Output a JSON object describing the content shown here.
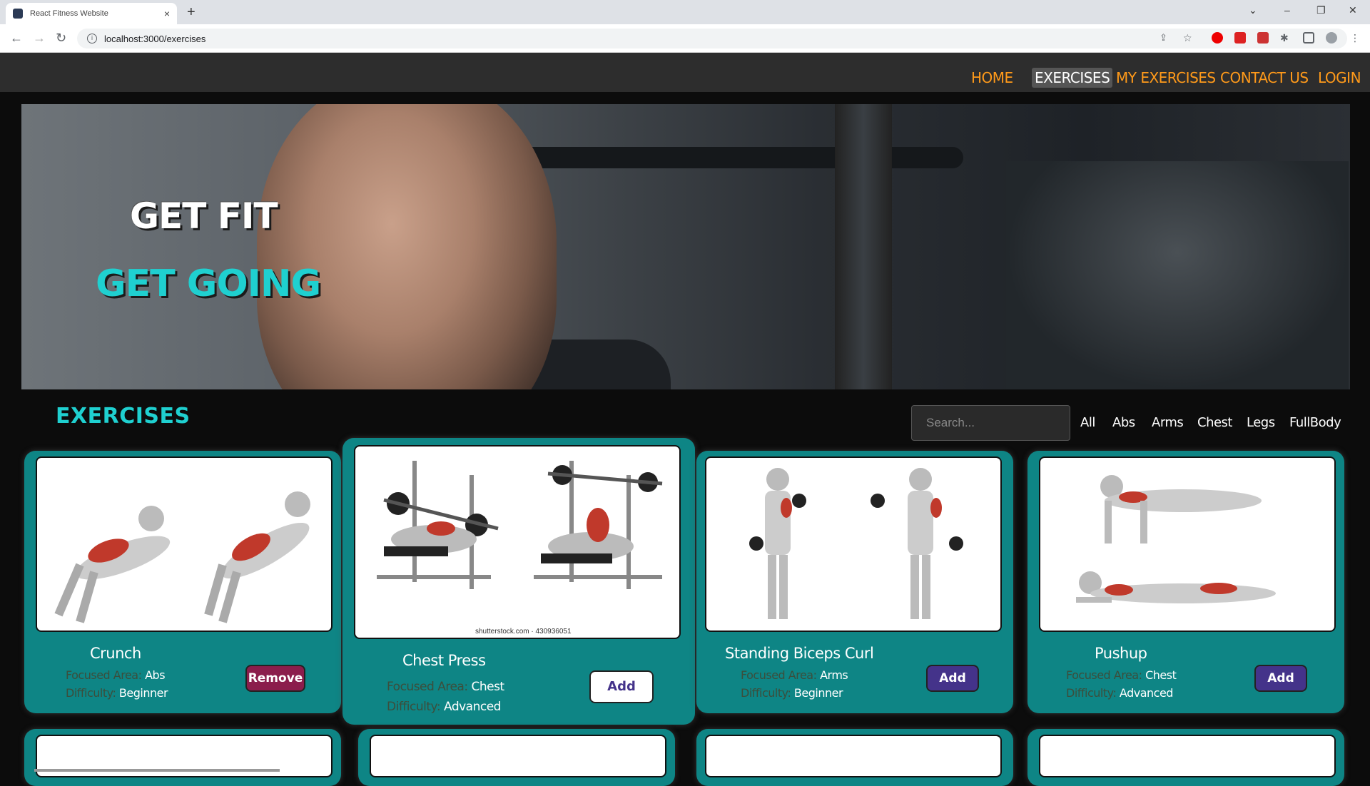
{
  "browser": {
    "tab_title": "React Fitness Website",
    "tab_close": "×",
    "new_tab": "+",
    "url": "localhost:3000/exercises",
    "controls": {
      "tabsearch": "⌄",
      "minimize": "–",
      "restore": "❐",
      "close": "✕"
    }
  },
  "nav": {
    "links": [
      "HOME",
      "EXERCISES",
      "MY EXERCISES",
      "CONTACT US",
      "LOGIN"
    ],
    "active": "EXERCISES"
  },
  "hero": {
    "line1": "GET FIT",
    "line2": "GET GOING"
  },
  "section": {
    "title": "EXERCISES",
    "search_placeholder": "Search...",
    "filters": [
      "All",
      "Abs",
      "Arms",
      "Chest",
      "Legs",
      "FullBody"
    ]
  },
  "labels": {
    "focused_area": "Focused Area:",
    "difficulty": "Difficulty:"
  },
  "cards": [
    {
      "name": "Crunch",
      "focused_area": "Abs",
      "difficulty": "Beginner",
      "button": "Remove"
    },
    {
      "name": "Chest Press",
      "focused_area": "Chest",
      "difficulty": "Advanced",
      "button": "Add",
      "watermark": "shutterstock.com · 430936051"
    },
    {
      "name": "Standing Biceps Curl",
      "focused_area": "Arms",
      "difficulty": "Beginner",
      "button": "Add"
    },
    {
      "name": "Pushup",
      "focused_area": "Chest",
      "difficulty": "Advanced",
      "button": "Add"
    }
  ],
  "colors": {
    "accent_teal": "#1fd0d0",
    "card_bg": "#0e8585",
    "nav_link": "#ff9a1a",
    "remove_btn": "#8b1d4c",
    "add_btn": "#44338a"
  }
}
